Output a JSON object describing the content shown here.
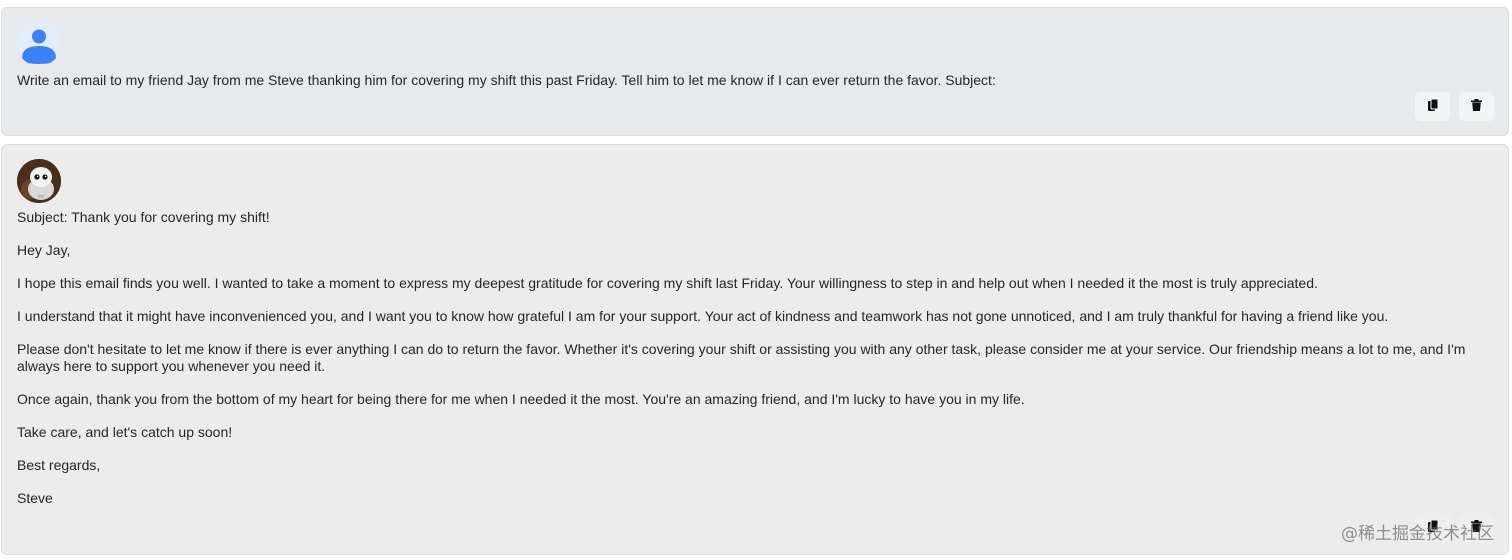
{
  "colors": {
    "user_bg": "#e8e9ec",
    "bot_bg": "#ececec",
    "user_avatar_accent": "#3b82f6"
  },
  "user_message": {
    "text": "Write an email to my friend Jay from me Steve thanking him for covering my shift this past Friday. Tell him to let me know if I can ever return the favor. Subject:",
    "actions": [
      {
        "icon": "copy-icon"
      },
      {
        "icon": "trash-icon"
      }
    ]
  },
  "bot_message": {
    "paragraphs": [
      "Subject: Thank you for covering my shift!",
      "Hey Jay,",
      "I hope this email finds you well. I wanted to take a moment to express my deepest gratitude for covering my shift last Friday. Your willingness to step in and help out when I needed it the most is truly appreciated.",
      "I understand that it might have inconvenienced you, and I want you to know how grateful I am for your support. Your act of kindness and teamwork has not gone unnoticed, and I am truly thankful for having a friend like you.",
      "Please don't hesitate to let me know if there is ever anything I can do to return the favor. Whether it's covering your shift or assisting you with any other task, please consider me at your service. Our friendship means a lot to me, and I'm always here to support you whenever you need it.",
      "Once again, thank you from the bottom of my heart for being there for me when I needed it the most. You're an amazing friend, and I'm lucky to have you in my life.",
      "Take care, and let's catch up soon!",
      "Best regards,",
      "Steve"
    ],
    "actions": [
      {
        "icon": "copy-icon"
      },
      {
        "icon": "trash-icon"
      }
    ]
  },
  "watermark": "@稀土掘金技术社区"
}
